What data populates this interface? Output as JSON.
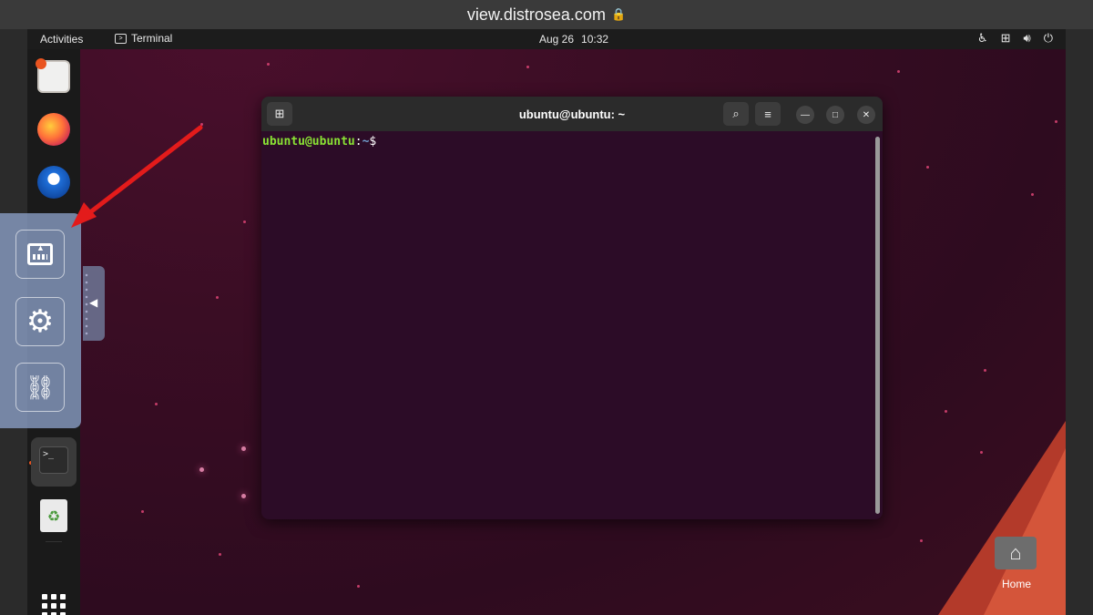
{
  "browser": {
    "url": "view.distrosea.com",
    "lock_icon": "lock-icon"
  },
  "topbar": {
    "activities": "Activities",
    "app_name": "Terminal",
    "date": "Aug 26",
    "time": "10:32",
    "tray_icons": [
      "accessibility-icon",
      "network-icon",
      "volume-icon",
      "power-icon"
    ]
  },
  "dock": {
    "items": [
      "help-icon",
      "firefox-icon",
      "thunderbird-icon",
      "terminal-icon",
      "trash-icon",
      "show-apps-icon"
    ],
    "terminal_glyph": ">_"
  },
  "side_menu": {
    "buttons": [
      "keyboard-icon",
      "gear-icon",
      "disconnect-icon"
    ]
  },
  "terminal": {
    "title": "ubuntu@ubuntu: ~",
    "prompt_user": "ubuntu@ubuntu",
    "prompt_sep": ":",
    "prompt_path": "~",
    "prompt_sym": "$"
  },
  "desktop": {
    "home_label": "Home"
  },
  "colors": {
    "accent": "#e95420",
    "arrow": "#e31b1b",
    "prompt_green": "#8ae234",
    "prompt_blue": "#729fcf"
  }
}
